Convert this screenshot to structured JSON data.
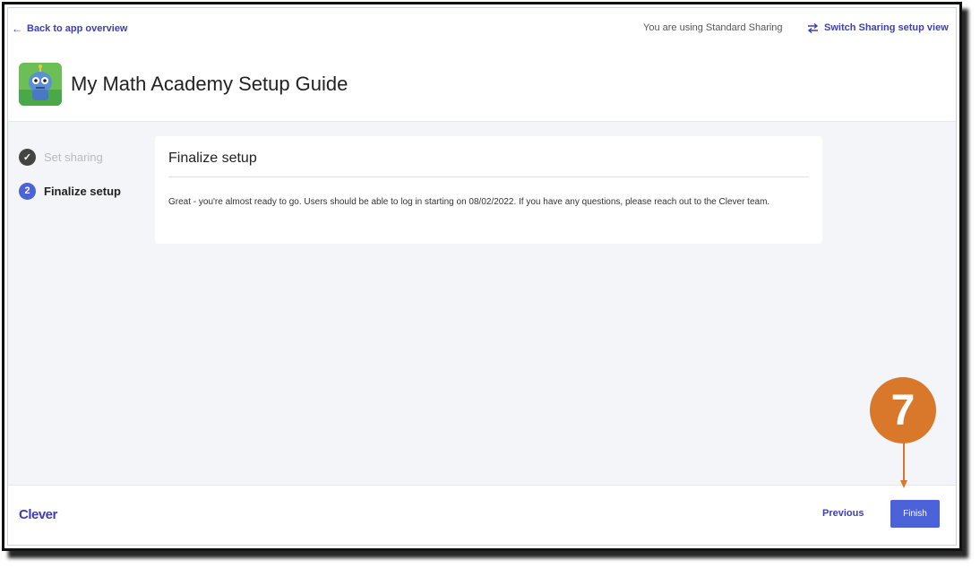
{
  "topbar": {
    "back_label": "Back to app overview",
    "sharing_status": "You are using Standard Sharing",
    "switch_label": "Switch Sharing setup view"
  },
  "header": {
    "title": "My Math Academy Setup Guide",
    "logo_icon": "robot-mascot-icon"
  },
  "steps": [
    {
      "number": "1",
      "label": "Set sharing",
      "state": "completed"
    },
    {
      "number": "2",
      "label": "Finalize setup",
      "state": "active"
    }
  ],
  "card": {
    "title": "Finalize setup",
    "body": "Great - you're almost ready to go. Users should be able to log in starting on 08/02/2022. If you have any questions, please reach out to the Clever team."
  },
  "footer": {
    "brand": "Clever",
    "previous_label": "Previous",
    "finish_label": "Finish"
  },
  "annotation": {
    "step_number": "7",
    "color": "#d9782a"
  },
  "colors": {
    "accent": "#4b62d8",
    "link": "#3d3fb0",
    "content_bg": "#f4f5f8"
  }
}
